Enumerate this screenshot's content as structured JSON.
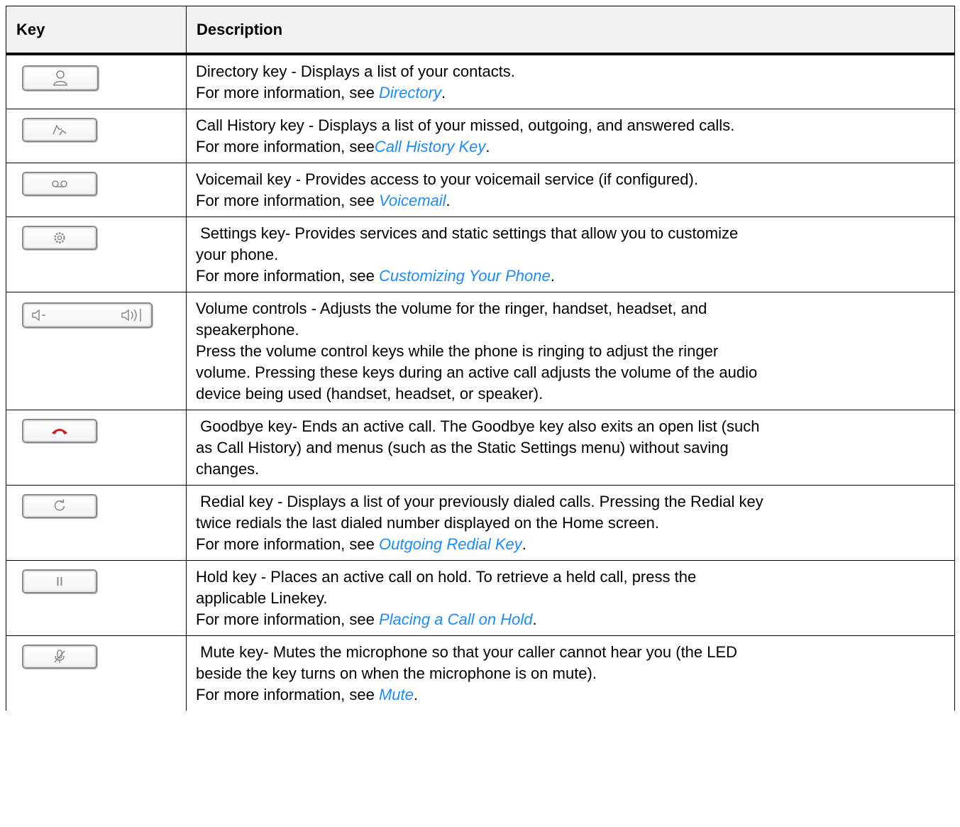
{
  "header": {
    "key": "Key",
    "description": "Description"
  },
  "rows": [
    {
      "icon": "directory-icon",
      "lines": [
        {
          "text": "Directory key - Displays a list of your contacts."
        },
        {
          "pre": "For more information, see ",
          "link": "Directory",
          "post": "."
        }
      ]
    },
    {
      "icon": "call-history-icon",
      "lines": [
        {
          "text": "Call History key - Displays a list of your missed, outgoing, and answered calls."
        },
        {
          "pre": "For more information, see",
          "link": "Call History Key",
          "post": "."
        }
      ]
    },
    {
      "icon": "voicemail-icon",
      "lines": [
        {
          "text": "Voicemail key - Provides access to your voicemail service (if configured)."
        },
        {
          "pre": "For more information, see ",
          "link": "Voicemail",
          "post": "."
        }
      ]
    },
    {
      "icon": "settings-gear-icon",
      "lines": [
        {
          "text": " Settings key- Provides services and static settings that allow you to customize"
        },
        {
          "text": "your phone."
        },
        {
          "pre": "For more information, see ",
          "link": "Customizing Your Phone",
          "post": "."
        }
      ]
    },
    {
      "icon": "volume-controls-icon",
      "lines": [
        {
          "text": "Volume controls - Adjusts the volume for the ringer, handset, headset, and"
        },
        {
          "text": "speakerphone."
        },
        {
          "text": "Press the volume control keys while the phone is ringing to adjust the ringer"
        },
        {
          "text": "volume. Pressing these keys during an active call adjusts the volume of the audio"
        },
        {
          "text": "device being used (handset, headset, or speaker)."
        }
      ]
    },
    {
      "icon": "goodbye-handset-icon",
      "lines": [
        {
          "text": " Goodbye key- Ends an active call. The Goodbye key also exits an open list (such"
        },
        {
          "text": "as Call History) and menus (such as the Static Settings menu) without saving"
        },
        {
          "text": "changes."
        }
      ]
    },
    {
      "icon": "redial-icon",
      "lines": [
        {
          "text": " Redial key - Displays a list of your previously dialed calls. Pressing the Redial key"
        },
        {
          "text": "twice redials the last dialed number displayed on the Home screen."
        },
        {
          "pre": "For more information, see ",
          "link": "Outgoing Redial Key",
          "post": "."
        }
      ]
    },
    {
      "icon": "hold-icon",
      "lines": [
        {
          "text": "Hold key - Places an active call on hold. To retrieve a held call, press the"
        },
        {
          "text": "applicable Linekey."
        },
        {
          "pre": "For more information, see ",
          "link": "Placing a Call on Hold",
          "post": "."
        }
      ]
    },
    {
      "icon": "mute-microphone-icon",
      "lines": [
        {
          "text": " Mute key- Mutes the microphone so that your caller cannot hear you (the LED"
        },
        {
          "text": "beside the key turns on when the microphone is on mute)."
        },
        {
          "pre": "For more information, see ",
          "link": "Mute",
          "post": "."
        }
      ]
    }
  ],
  "colors": {
    "link": "#1a8cff",
    "header_bg": "#f2f2f2",
    "goodbye_icon": "#cc1f1f"
  }
}
